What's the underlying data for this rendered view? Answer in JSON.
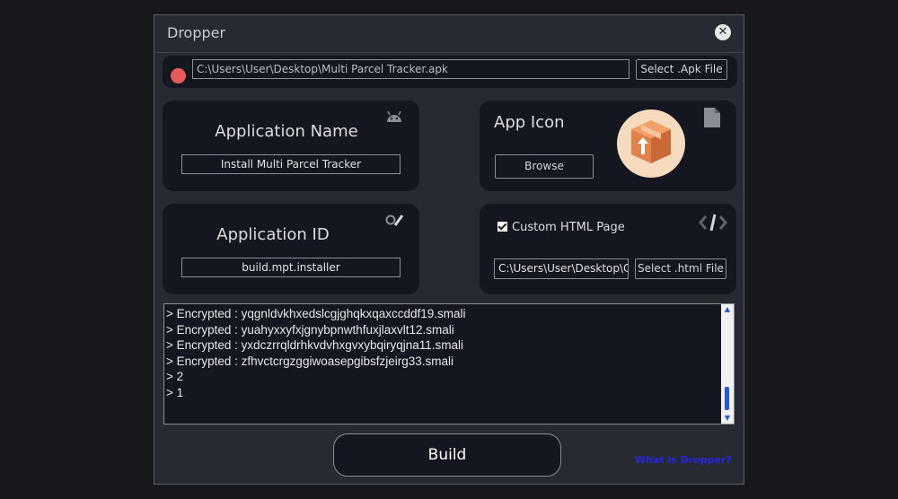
{
  "window": {
    "title": "Dropper"
  },
  "apk": {
    "path": "C:\\Users\\User\\Desktop\\Multi Parcel Tracker.apk",
    "select_label": "Select .Apk File"
  },
  "app_name": {
    "heading": "Application Name",
    "value": "Install Multi Parcel Tracker"
  },
  "app_icon": {
    "heading": "App Icon",
    "browse_label": "Browse"
  },
  "app_id": {
    "heading": "Application ID",
    "value": "build.mpt.installer"
  },
  "custom_html": {
    "checkbox_label": "Custom HTML Page",
    "checked": true,
    "path": "C:\\Users\\User\\Desktop\\Custom",
    "select_label": "Select .html File"
  },
  "console": {
    "lines": [
      "> Encrypted : yqgnldvkhxedslcgjghqkxqaxccddf19.smali",
      "> Encrypted : yuahyxxyfxjgnybpnwthfuxjlaxvlt12.smali",
      "> Encrypted : yxdczrrqldrhkvdvhxgvxybqiryqjna11.smali",
      "> Encrypted : zfhvctcrgzggiwoasepgibsfzjeirg33.smali",
      "> 2",
      "> 1"
    ]
  },
  "build_label": "Build",
  "help_link": "What is Dropper?",
  "colors": {
    "status_dot": "#e85a5a",
    "link": "#2626e0",
    "scrollbar_accent": "#2456d6"
  },
  "icons": [
    "close-icon",
    "android-icon",
    "file-icon",
    "box-app-icon",
    "pencil-icon",
    "code-icon",
    "checkbox-check-icon"
  ]
}
